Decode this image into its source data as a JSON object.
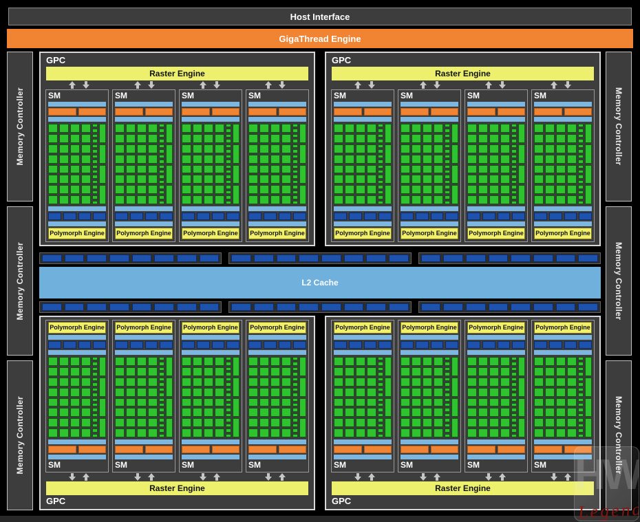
{
  "top_bars": {
    "host_interface": "Host Interface",
    "gigathread_engine": "GigaThread Engine"
  },
  "labels": {
    "gpc": "GPC",
    "raster_engine": "Raster Engine",
    "sm": "SM",
    "polymorph_engine": "Polymorph Engine",
    "l2_cache": "L2 Cache",
    "memory_controller": "Memory Controller"
  },
  "watermark": {
    "monogram": "HW",
    "script": "Legend"
  },
  "structure": {
    "gpc_count": 4,
    "sms_per_gpc": 4,
    "memory_controllers_per_side": 3,
    "core_rows": 8,
    "core_cols": 4,
    "ldst_units": 16,
    "sfu_units": 4,
    "scheduler_segments": 2,
    "interconnect_segments": 4,
    "strip_groups_per_row": 3,
    "segments_per_strip_group": 8,
    "arrow_pairs_per_gpc": 4
  },
  "colors": {
    "background": "#000000",
    "block_gray": "#3d3d3d",
    "strip_gray": "#2d2d2d",
    "orange": "#f08433",
    "raster_yellow": "#edf06c",
    "poly_yellow": "#f2ef69",
    "light_blue": "#7db7e0",
    "l2_blue": "#6fb0dc",
    "dark_blue": "#1d52ae",
    "core_green": "#2fc42f",
    "arrow_gray": "#c6c6c6"
  }
}
